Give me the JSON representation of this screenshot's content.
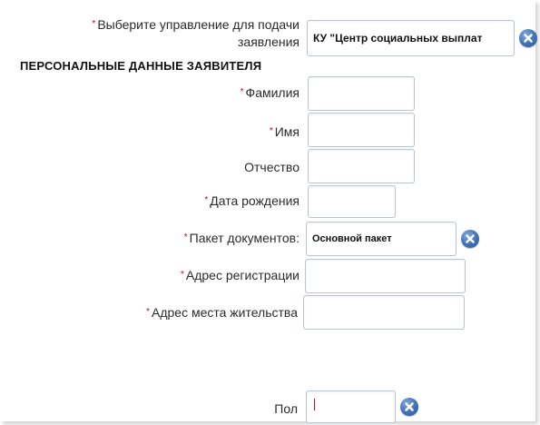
{
  "form": {
    "required_mark": "*",
    "department": {
      "label_line1": "Выберите управление для подачи",
      "label_line2": "заявления",
      "value": "КУ \"Центр социальных выплат"
    },
    "section_title": "ПЕРСОНАЛЬНЫЕ ДАННЫЕ ЗАЯВИТЕЛЯ",
    "surname": {
      "label": "Фамилия",
      "value": ""
    },
    "name": {
      "label": "Имя",
      "value": ""
    },
    "patronymic": {
      "label": "Отчество",
      "value": ""
    },
    "birth_date": {
      "label": "Дата рождения",
      "value": ""
    },
    "document_package": {
      "label": "Пакет документов:",
      "value": "Основной пакет"
    },
    "registration_address": {
      "label": "Адрес регистрации",
      "value": ""
    },
    "residence_address": {
      "label": "Адрес места жительства",
      "value": ""
    },
    "gender": {
      "label": "Пол",
      "value": ""
    }
  },
  "colors": {
    "required": "#d0021b",
    "field_border": "#b9c4d4",
    "clear_button": "#3f71b6"
  },
  "icons": {
    "clear": "close-icon"
  }
}
